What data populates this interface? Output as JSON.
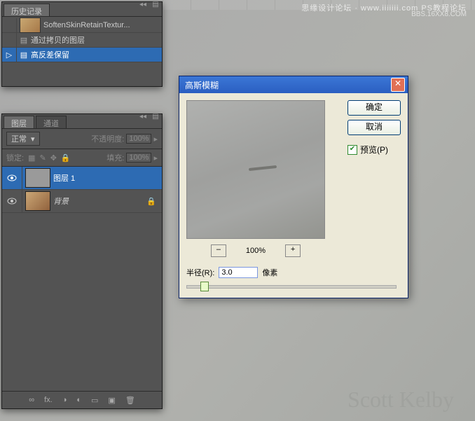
{
  "watermark": {
    "line1": "思缘设计论坛 · www.iiiiiii.com  PS教程论坛",
    "line2": "BBS.16XX8.COM"
  },
  "signature": "Scott Kelby",
  "history": {
    "tab": "历史记录",
    "items": [
      {
        "label": "SoftenSkinRetainTextur..."
      },
      {
        "label": "通过拷贝的图层"
      },
      {
        "label": "高反差保留"
      }
    ]
  },
  "layers": {
    "tabs": [
      "图层",
      "通道"
    ],
    "blend_mode": "正常",
    "opacity_label": "不透明度:",
    "opacity_value": "100%",
    "lock_label": "锁定:",
    "fill_label": "填充:",
    "fill_value": "100%",
    "items": [
      {
        "name": "图层 1",
        "selected": true
      },
      {
        "name": "背景",
        "selected": false
      }
    ],
    "footer_icons": [
      "∞",
      "fx.",
      "◑",
      "◐",
      "▭",
      "▣",
      "🗑"
    ]
  },
  "dialog": {
    "title": "高斯模糊",
    "ok": "确定",
    "cancel": "取消",
    "preview": "预览(P)",
    "zoom_out": "–",
    "zoom_pct": "100%",
    "zoom_in": "+",
    "radius_label": "半径(R):",
    "radius_value": "3.0",
    "radius_unit": "像素"
  }
}
